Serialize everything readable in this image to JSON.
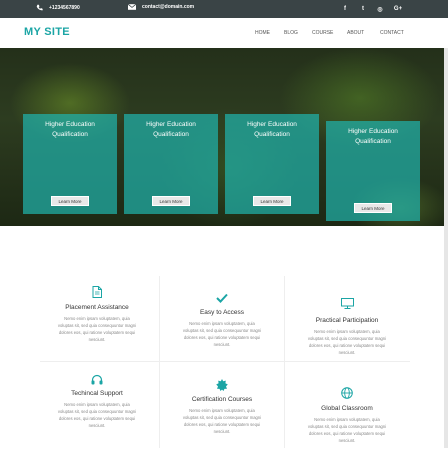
{
  "topbar": {
    "phone": "+1234567890",
    "email": "contact@domain.com",
    "phone_icon": "phone-icon",
    "email_icon": "envelope-icon",
    "social": [
      {
        "name": "facebook-icon",
        "glyph": "f"
      },
      {
        "name": "twitter-icon",
        "glyph": "t"
      },
      {
        "name": "instagram-icon",
        "glyph": "◎"
      },
      {
        "name": "google-plus-icon",
        "glyph": "G+"
      }
    ]
  },
  "nav": {
    "logo": "MY SITE",
    "items": [
      "HOME",
      "BLOG",
      "COURSE",
      "ABOUT",
      "CONTACT"
    ]
  },
  "hero": {
    "cards": [
      {
        "title_line1": "Higher Education",
        "title_line2": "Qualification",
        "button": "Learn More"
      },
      {
        "title_line1": "Higher Education",
        "title_line2": "Qualification",
        "button": "Learn More"
      },
      {
        "title_line1": "Higher Education",
        "title_line2": "Qualification",
        "button": "Learn More"
      },
      {
        "title_line1": "Higher Education",
        "title_line2": "Qualification",
        "button": "Learn More"
      }
    ]
  },
  "features": {
    "accent": "#1ba5a5",
    "items": [
      {
        "icon": "document-icon",
        "title": "Placement Assistance",
        "desc1": "Nemo enim ipsam voluptatem, quia",
        "desc2": "voluptas sit, sed quia consequuntur magni",
        "desc3": "dolores eos, qui ratione voluptatem sequi",
        "desc4": "nesciunt."
      },
      {
        "icon": "checkmark-icon",
        "title": "Easy to Access",
        "desc1": "Nemo enim ipsam voluptatem, quia",
        "desc2": "voluptas sit, sed quia consequuntur magni",
        "desc3": "dolores eos, qui ratione voluptatem sequi",
        "desc4": "nesciunt."
      },
      {
        "icon": "monitor-icon",
        "title": "Practical Participation",
        "desc1": "Nemo enim ipsam voluptatem, quia",
        "desc2": "voluptas sit, sed quia consequuntur magni",
        "desc3": "dolores eos, qui ratione voluptatem sequi",
        "desc4": "nesciunt."
      },
      {
        "icon": "headphones-icon",
        "title": "Techincal Support",
        "desc1": "Nemo enim ipsam voluptatem, quia",
        "desc2": "voluptas sit, sed quia consequuntur magni",
        "desc3": "dolores eos, qui ratione voluptatem sequi",
        "desc4": "nesciunt."
      },
      {
        "icon": "certificate-icon",
        "title": "Certification Courses",
        "desc1": "Nemo enim ipsam voluptatem, quia",
        "desc2": "voluptas sit, sed quia consequuntur magni",
        "desc3": "dolores eos, qui ratione voluptatem sequi",
        "desc4": "nesciunt."
      },
      {
        "icon": "globe-icon",
        "title": "Global Classroom",
        "desc1": "Nemo enim ipsam voluptatem, quia",
        "desc2": "voluptas sit, sed quia consequuntur magni",
        "desc3": "dolores eos, qui ratione voluptatem sequi",
        "desc4": "nesciunt."
      }
    ]
  }
}
